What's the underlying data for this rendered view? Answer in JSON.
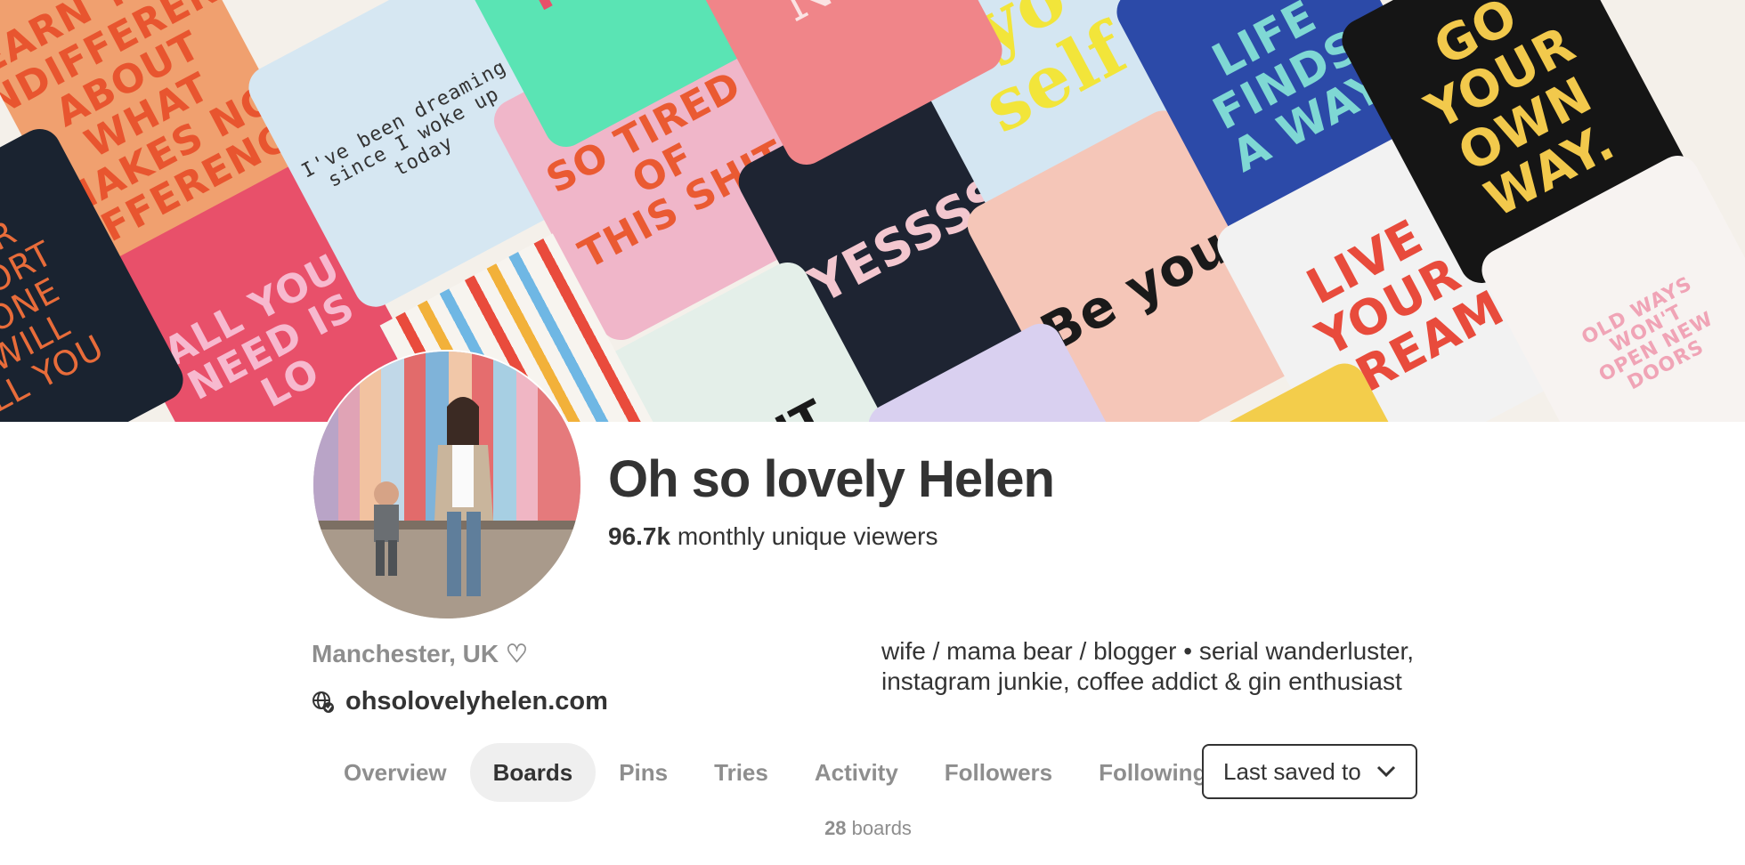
{
  "cover": {
    "tiles": [
      {
        "text": "LEARN TO BE\nINDIFFERENT\nABOUT WHAT\nMAKES NO\nDIFFERENCE",
        "bg": "#f0a06f",
        "fg": "#e8552f"
      },
      {
        "text": "ALL YOU\nNEED IS\nLO",
        "bg": "#e8506a",
        "fg": "#f7b9cf"
      },
      {
        "text": "I've been dreaming since I woke up today",
        "bg": "#d6e7f2",
        "fg": "#333333"
      },
      {
        "text": "SO TIRED OF\nTHIS SHIT",
        "bg": "#f0b6c9",
        "fg": "#ea5a32"
      },
      {
        "text": "YESSSS",
        "bg": "#1e2432",
        "fg": "#f3c7cf"
      },
      {
        "text": "yo\nself",
        "bg": "#d4e6f2",
        "fg": "#f2e53a"
      },
      {
        "text": "Be you",
        "bg": "#f5c6b8",
        "fg": "#1a1a1a"
      },
      {
        "text": "LIFE\nFINDS\nA WAY",
        "bg": "#2c4aa8",
        "fg": "#7fd8d4"
      },
      {
        "text": "LIVE\nYOUR\nDREAM",
        "bg": "#f2f2f2",
        "fg": "#e84b3c"
      },
      {
        "text": "GO\nYOUR\nOWN\nWAY.",
        "bg": "#151515",
        "fg": "#f2c94c"
      },
      {
        "text": "OLD WAYS\nWON'T\nOPEN NEW\nDOORS",
        "bg": "#f7f3f1",
        "fg": "#f0a4b6"
      },
      {
        "text": "OUR\nMFORT\nZONE\nWILL\nLL YOU",
        "bg": "#1a2330",
        "fg": "#e86c3a"
      },
      {
        "text": "NK IT",
        "bg": "#e4efe9",
        "fg": "#1a1a1a"
      },
      {
        "text": "MEH",
        "bg": "#5ae4b4",
        "fg": "#e8506a"
      },
      {
        "text": "Nej",
        "bg": "#f08589",
        "fg": "#fbe3e3"
      }
    ]
  },
  "profile": {
    "name": "Oh so lovely Helen",
    "viewers_count": "96.7k",
    "viewers_label": " monthly unique viewers",
    "location": "Manchester, UK ♡",
    "website": "ohsolovelyhelen.com",
    "bio_line1": "wife / mama bear / blogger • serial wanderluster,",
    "bio_line2": "instagram junkie, coffee addict & gin enthusiast"
  },
  "tabs": [
    {
      "label": "Overview",
      "active": false
    },
    {
      "label": "Boards",
      "active": true
    },
    {
      "label": "Pins",
      "active": false
    },
    {
      "label": "Tries",
      "active": false
    },
    {
      "label": "Activity",
      "active": false
    },
    {
      "label": "Followers",
      "active": false
    },
    {
      "label": "Following",
      "active": false
    }
  ],
  "sort_select": {
    "value": "Last saved to",
    "icon": "chevron-down-icon"
  },
  "board_count": {
    "number": "28",
    "label": " boards"
  },
  "colors": {
    "text": "#333333",
    "muted": "#8e8e8e",
    "active_tab_bg": "#efefef"
  }
}
